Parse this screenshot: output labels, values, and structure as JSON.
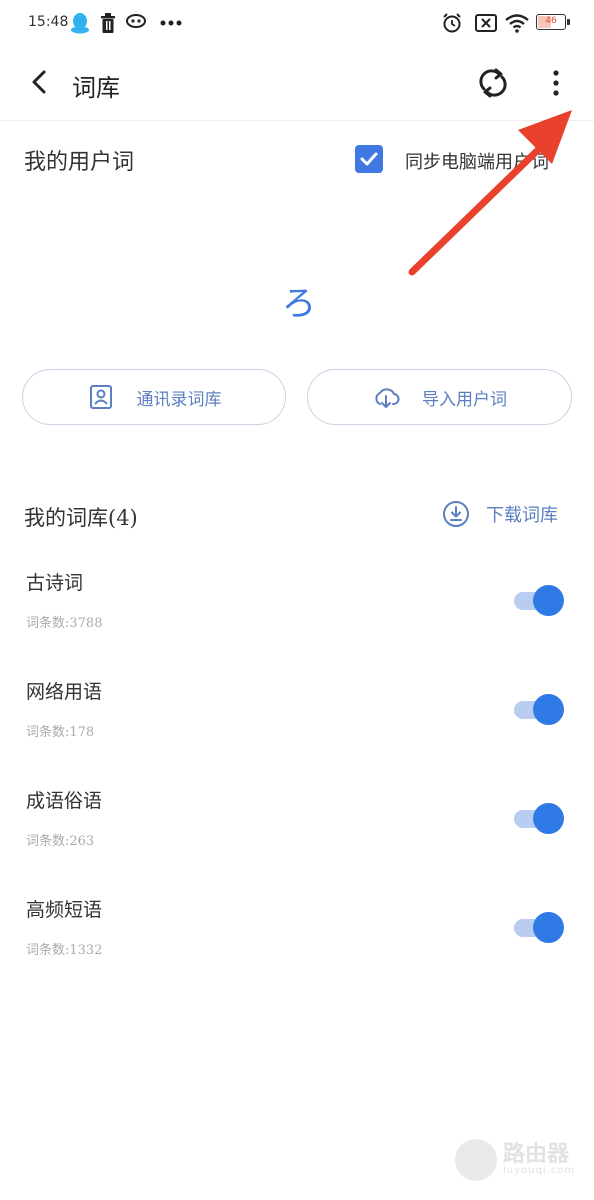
{
  "status_bar": {
    "time": "15:48",
    "battery": "46"
  },
  "header": {
    "title": "词库"
  },
  "user_words": {
    "title": "我的用户词",
    "sync_label": "同步电脑端用户词",
    "sync_checked": true,
    "loading_glyph": "ろ",
    "contacts_button": "通讯录词库",
    "import_button": "导入用户词"
  },
  "dictionaries": {
    "title": "我的词库(4)",
    "download_label": "下载词库",
    "items": [
      {
        "name": "古诗词",
        "count": "词条数:3788",
        "enabled": true
      },
      {
        "name": "网络用语",
        "count": "词条数:178",
        "enabled": true
      },
      {
        "name": "成语俗语",
        "count": "词条数:263",
        "enabled": true
      },
      {
        "name": "高频短语",
        "count": "词条数:1332",
        "enabled": true
      }
    ]
  },
  "watermark": {
    "cn": "路由器",
    "en": "luyouqi.com"
  },
  "colors": {
    "accent": "#2f7ae5",
    "arrow": "#e8412c"
  }
}
